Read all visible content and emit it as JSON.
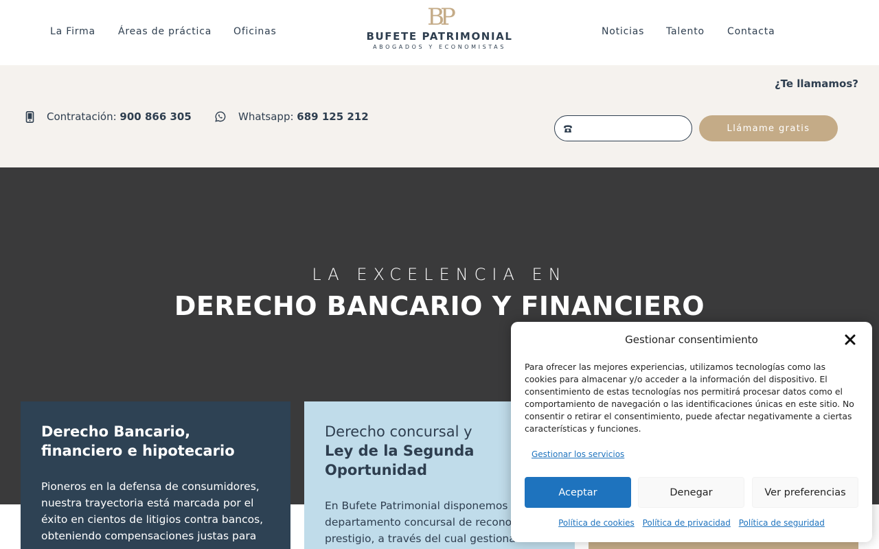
{
  "header": {
    "nav_left": [
      "La Firma",
      "Áreas de práctica",
      "Oficinas"
    ],
    "nav_right": [
      "Noticias",
      "Talento",
      "Contacta"
    ],
    "logo": {
      "monogram": "BP",
      "name": "BUFETE PATRIMONIAL",
      "tagline": "ABOGADOS Y ECONOMISTAS"
    }
  },
  "contact_bar": {
    "callback_title": "¿Te llamamos?",
    "hiring_label": "Contratación:",
    "hiring_number": "900 866 305",
    "whatsapp_label": "Whatsapp:",
    "whatsapp_number": "689 125 212",
    "phone_input_placeholder": "",
    "callback_button": "Llámame gratis"
  },
  "hero": {
    "eyebrow": "LA EXCELENCIA EN",
    "title": "DERECHO BANCARIO Y FINANCIERO"
  },
  "cards": [
    {
      "title": "Derecho Bancario, financiero e hipotecario",
      "text": "Pioneros en la defensa de consumidores, nuestra trayectoria está marcada por el éxito en cientos de litigios contra bancos, obteniendo compensaciones justas para"
    },
    {
      "title_light": "Derecho concursal y",
      "title_bold": "Ley de la Segunda Oportunidad",
      "text": "En Bufete Patrimonial disponemos de un departamento concursal de reconocido prestigio, a través del cual gestionamos"
    }
  ],
  "consent": {
    "title": "Gestionar consentimiento",
    "body": "Para ofrecer las mejores experiencias, utilizamos tecnologías como las cookies para almacenar y/o acceder a la información del dispositivo. El consentimiento de estas tecnologías nos permitirá procesar datos como el comportamiento de navegación o las identificaciones únicas en este sitio. No consentir o retirar el consentimiento, puede afectar negativamente a ciertas características y funciones.",
    "manage_services": "Gestionar los servicios",
    "accept": "Aceptar",
    "deny": "Denegar",
    "preferences": "Ver preferencias",
    "links": [
      "Política de cookies",
      "Política de privacidad",
      "Política de seguridad"
    ]
  },
  "colors": {
    "navy": "#2e3e4f",
    "gold": "#c4ab87",
    "hero_bg": "#3a3a3b",
    "card_navy": "#2e4254",
    "card_light_blue": "#c0dcea",
    "consent_blue": "#1e73be"
  },
  "icons": {
    "hiring": "mobile-phone-icon",
    "whatsapp": "whatsapp-icon",
    "phone_input": "telephone-icon",
    "close": "close-icon"
  }
}
